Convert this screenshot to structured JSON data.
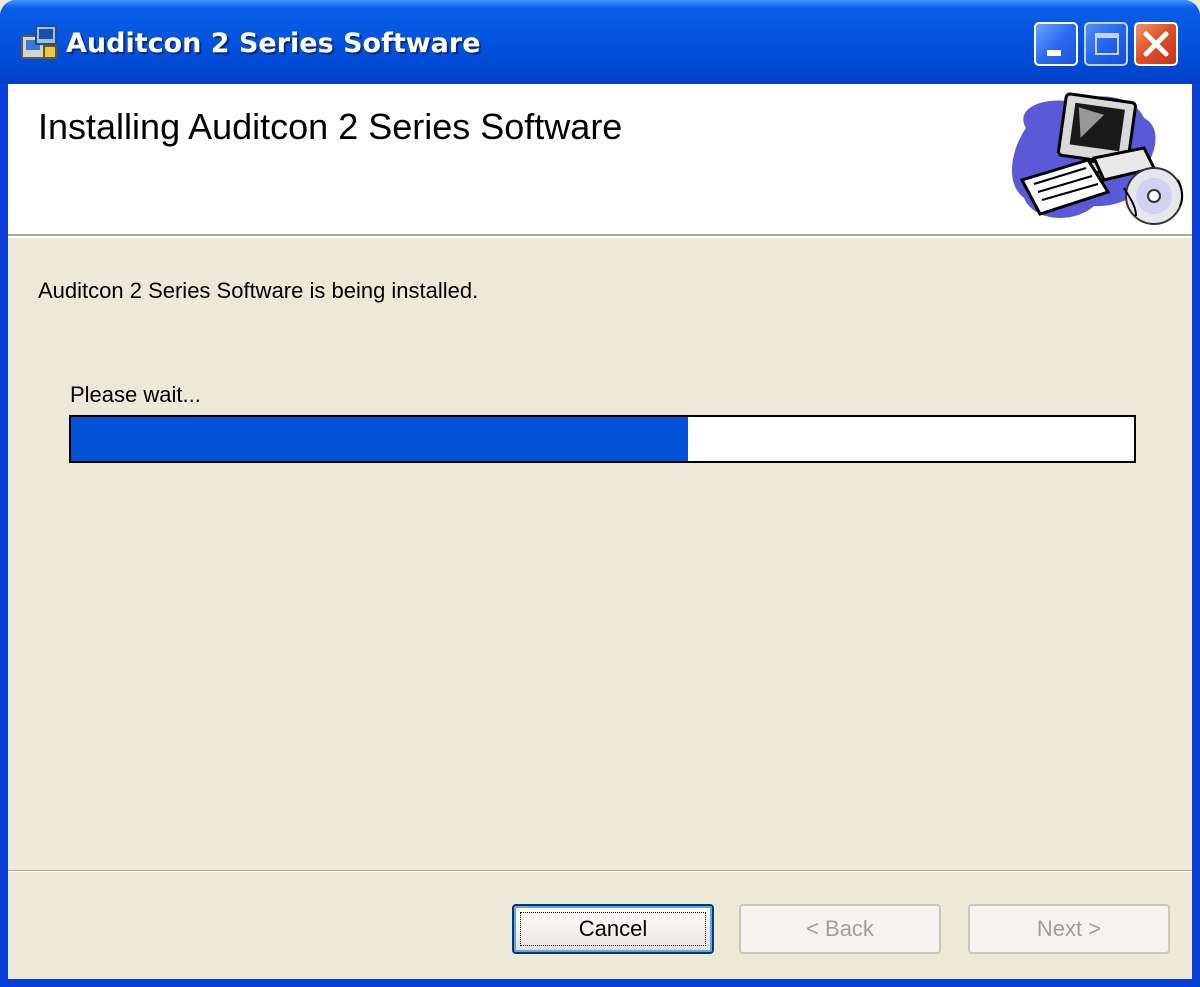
{
  "window": {
    "title": "Auditcon 2 Series Software",
    "controls": {
      "minimize_icon": "minimize-icon",
      "maximize_icon": "maximize-icon",
      "close_icon": "close-icon"
    }
  },
  "header": {
    "title": "Installing Auditcon 2 Series Software",
    "art_icon": "computer-cd-icon"
  },
  "body": {
    "status": "Auditcon 2 Series Software is being installed.",
    "wait_label": "Please wait...",
    "progress_percent": 58
  },
  "buttons": {
    "cancel": "Cancel",
    "back": "< Back",
    "next": "Next >"
  },
  "colors": {
    "titlebar": "#0355df",
    "progress_fill": "#0452d6",
    "dialog_bg": "#ece9d8",
    "close_button": "#e0522a"
  }
}
